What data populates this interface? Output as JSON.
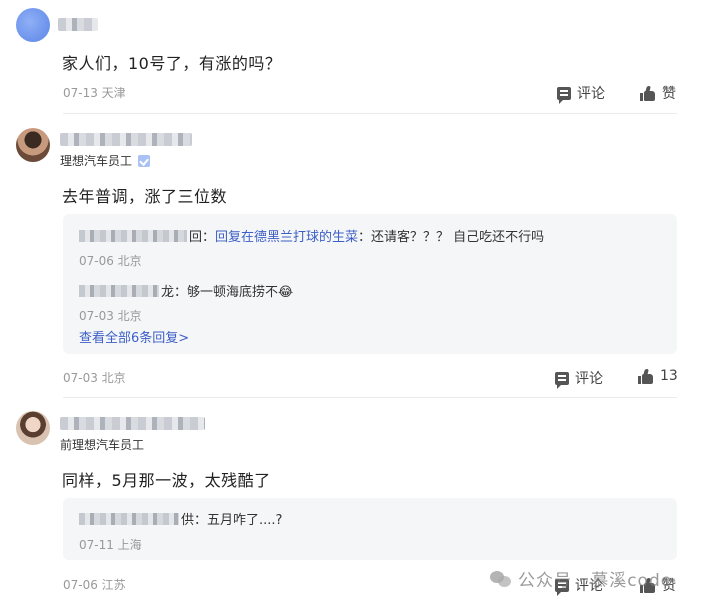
{
  "comments": [
    {
      "title": "",
      "content": "家人们，10号了，有涨的吗？",
      "meta": "07-13 天津",
      "comment_label": "评论",
      "like_label": "赞",
      "replies": []
    },
    {
      "title": "理想汽车员工",
      "content": "去年普调，涨了三位数",
      "meta": "07-03 北京",
      "comment_label": "评论",
      "like_label": "13",
      "replies": [
        {
          "suffix": "回：",
          "reply_to": "回复在德黑兰打球的生菜",
          "text": "：还请客？？？ 自己吃还不行吗",
          "meta": "07-06 北京"
        },
        {
          "suffix": "龙",
          "reply_to": "",
          "text": "：够一顿海底捞不😂",
          "meta": "07-03 北京"
        }
      ],
      "view_all": "查看全部6条回复>"
    },
    {
      "title": "前理想汽车员工",
      "content": "同样，5月那一波，太残酷了",
      "meta": "07-06 江苏",
      "comment_label": "评论",
      "like_label": "赞",
      "replies": [
        {
          "suffix": "供",
          "reply_to": "",
          "text": "：五月咋了....?",
          "meta": "07-11 上海"
        }
      ]
    }
  ],
  "watermark": "公众号 · 慕溪code",
  "icons": {
    "comment": "comment-icon",
    "like": "thumbs-up-icon",
    "verified": "verified-badge-icon",
    "watermark": "wechat-icon"
  },
  "colors": {
    "link": "#3d5fc5",
    "meta": "#999999",
    "reply_bg": "#f5f6f8"
  }
}
